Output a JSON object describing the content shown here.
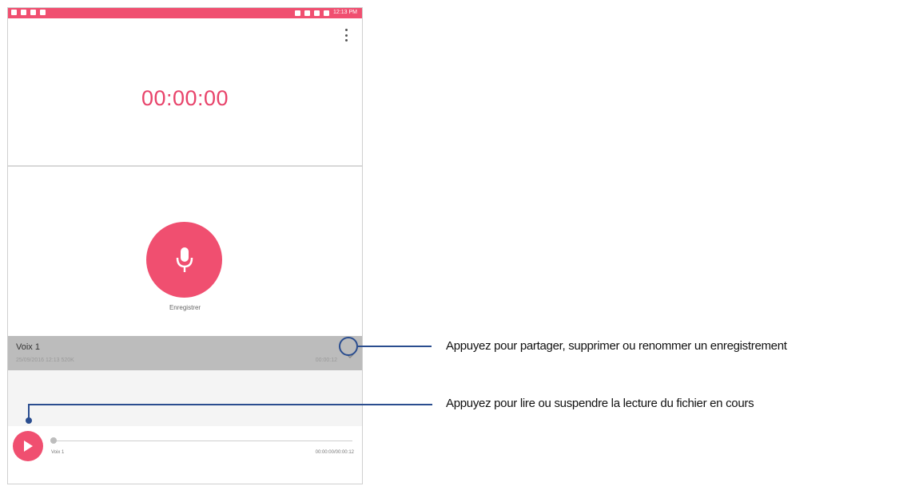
{
  "timer": "00:00:00",
  "record": {
    "label": "Enregistrer"
  },
  "recording": {
    "title": "Voix 1",
    "meta": "25/09/2016 12:13   520K",
    "duration": "00:00:12"
  },
  "player": {
    "name": "Voix 1",
    "time": "00:00:00/00:00:12"
  },
  "statusbar": {
    "time": "12:13 PM"
  },
  "callouts": {
    "options": "Appuyez pour partager, supprimer ou renommer un enregistrement",
    "play": "Appuyez pour lire ou suspendre la lecture du fichier en cours"
  },
  "colors": {
    "accent": "#f04f70",
    "callout": "#2a4d8f"
  }
}
